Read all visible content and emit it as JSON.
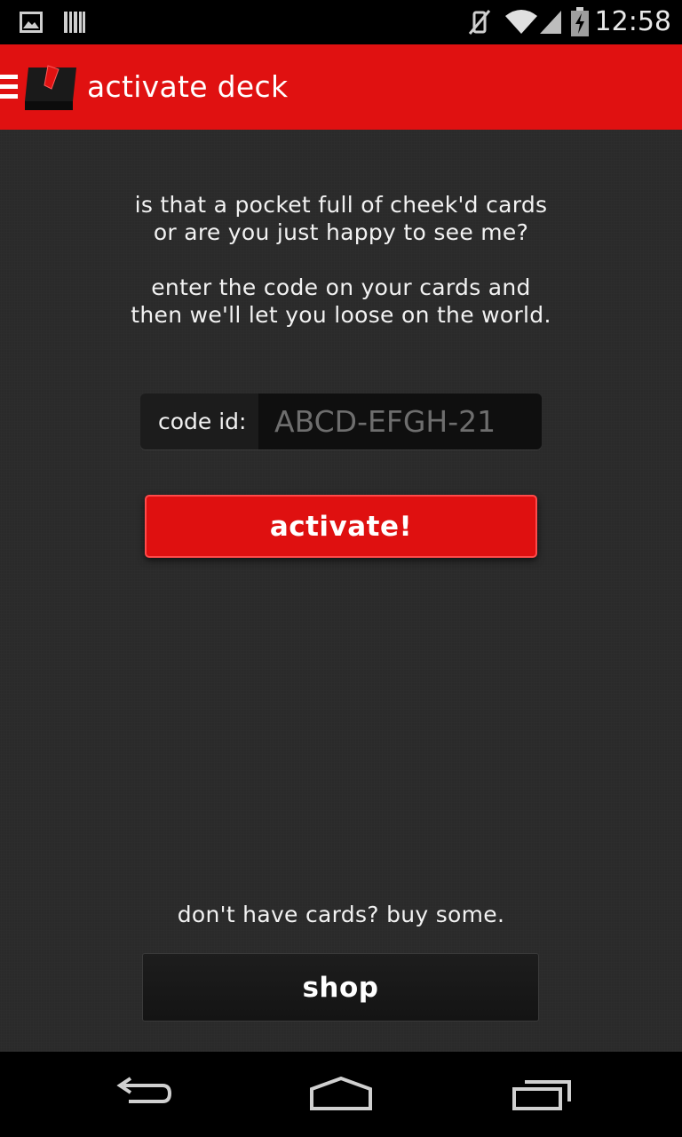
{
  "status_bar": {
    "time": "12:58",
    "icons": [
      "image-icon",
      "barcode-icon",
      "mute-icon",
      "wifi-icon",
      "signal-icon",
      "battery-icon"
    ]
  },
  "app_bar": {
    "title": "activate deck",
    "icons": [
      "menu-icon",
      "card-box-logo-icon"
    ]
  },
  "intro": {
    "line1": "is that a pocket full of cheek'd cards",
    "line2": "or are you just happy to see me?",
    "line3": "enter the code on your cards and",
    "line4": "then we'll let you loose on the world."
  },
  "code_form": {
    "label": "code id:",
    "placeholder": "ABCD-EFGH-21",
    "value": ""
  },
  "activate_label": "activate!",
  "buy_text": "don't have cards? buy some.",
  "shop_label": "shop",
  "nav_bar": {
    "icons": [
      "back-icon",
      "home-icon",
      "recents-icon"
    ]
  },
  "colors": {
    "accent": "#e01111",
    "background": "#2a2a2a",
    "input_bg": "#0f0f0f"
  }
}
